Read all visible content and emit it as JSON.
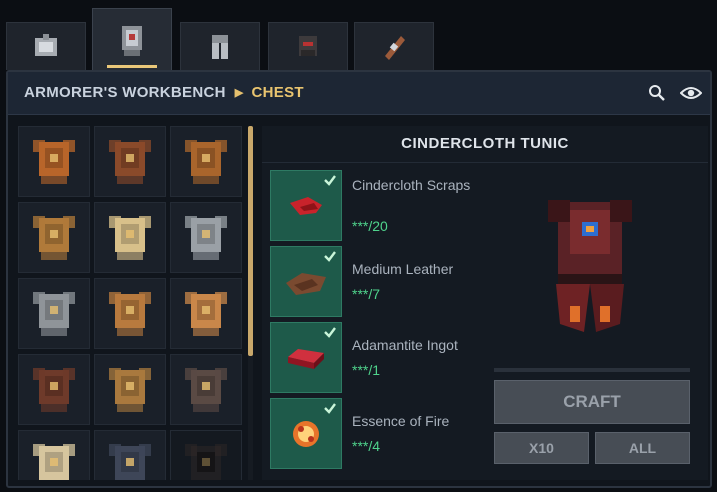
{
  "tabs": [
    {
      "icon": "armor-stand-icon",
      "active": false
    },
    {
      "icon": "chestplate-icon",
      "active": true
    },
    {
      "icon": "leggings-icon",
      "active": false
    },
    {
      "icon": "helmet-icon",
      "active": false
    },
    {
      "icon": "weapon-icon",
      "active": false
    }
  ],
  "header": {
    "parent": "ARMORER'S WORKBENCH",
    "current": "CHEST",
    "search_icon": "search-icon",
    "view_icon": "eye-icon"
  },
  "grid": {
    "items": [
      {
        "icon": "copper-chestplate-icon",
        "color": "#b8652a"
      },
      {
        "icon": "leather-chestplate-icon",
        "color": "#8a4a2a"
      },
      {
        "icon": "copper-vest-icon",
        "color": "#a9652c"
      },
      {
        "icon": "bronze-chestplate-icon",
        "color": "#b07a3a"
      },
      {
        "icon": "wool-robe-icon",
        "color": "#d8c08a"
      },
      {
        "icon": "iron-chestplate-icon",
        "color": "#9aa0a6"
      },
      {
        "icon": "steel-chestplate-icon",
        "color": "#8f9499"
      },
      {
        "icon": "fringed-vest-icon",
        "color": "#b87a3e"
      },
      {
        "icon": "cloth-tunic-icon",
        "color": "#c9874a"
      },
      {
        "icon": "dark-leather-icon",
        "color": "#6e3a2a"
      },
      {
        "icon": "studded-vest-icon",
        "color": "#a9793e"
      },
      {
        "icon": "cobalt-vest-icon",
        "color": "#5a4a44"
      },
      {
        "icon": "fur-chestplate-icon",
        "color": "#d6c59e"
      },
      {
        "icon": "shadow-chestplate-icon",
        "color": "#3e4658"
      },
      {
        "icon": "locked-chestplate-icon",
        "color": "#3a2e2a"
      }
    ]
  },
  "recipe": {
    "title": "CINDERCLOTH TUNIC",
    "ingredients": [
      {
        "name": "Cindercloth Scraps",
        "qty": "***/20",
        "icon": "cloth-scrap-icon",
        "color": "#c8232b"
      },
      {
        "name": "Medium Leather",
        "qty": "***/7",
        "icon": "leather-icon",
        "color": "#7a4a30"
      },
      {
        "name": "Adamantite Ingot",
        "qty": "***/1",
        "icon": "ingot-icon",
        "color": "#b21e2e"
      },
      {
        "name": "Essence of Fire",
        "qty": "***/4",
        "icon": "fire-essence-icon",
        "color": "#e8742a"
      }
    ],
    "preview_icon": "cindercloth-tunic-icon",
    "progress": 0,
    "craft_label": "CRAFT",
    "x10_label": "X10",
    "all_label": "ALL"
  },
  "colors": {
    "accent": "#e9c46f",
    "ingredient_bg": "#1e5a4a",
    "qty_text": "#4fd38c"
  }
}
